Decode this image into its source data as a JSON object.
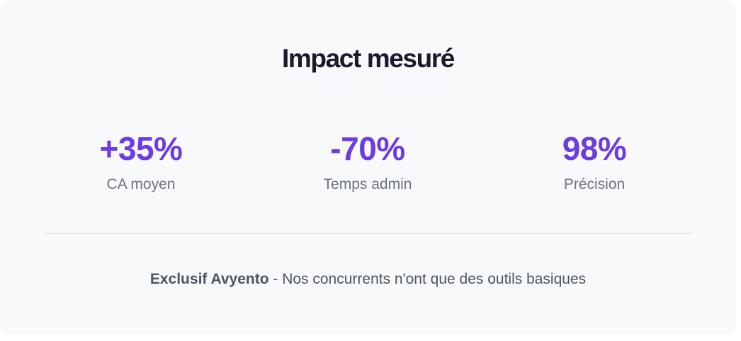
{
  "title": "Impact mesuré",
  "stats": [
    {
      "value": "+35%",
      "label": "CA moyen"
    },
    {
      "value": "-70%",
      "label": "Temps admin"
    },
    {
      "value": "98%",
      "label": "Précision"
    }
  ],
  "footnote": {
    "highlight": "Exclusif Avyento",
    "text": " - Nos concurrents n'ont que des outils basiques"
  },
  "colors": {
    "accent": "#6d3be2",
    "title": "#191b2c",
    "muted": "#6b7280",
    "background": "#f8f9fb"
  }
}
